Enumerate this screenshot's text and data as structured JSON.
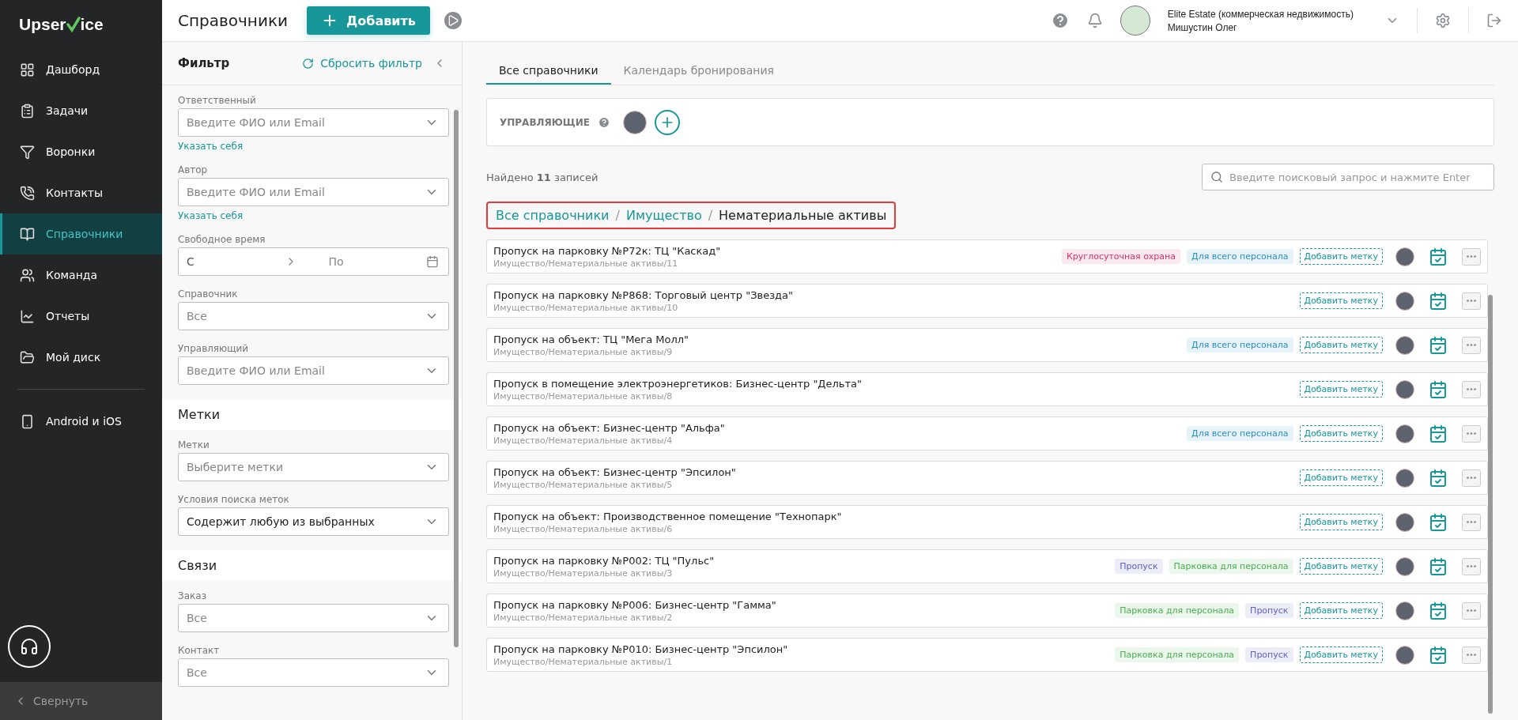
{
  "logo": {
    "before": "Upser",
    "after": "ice"
  },
  "nav": [
    {
      "label": "Дашборд",
      "selected": false
    },
    {
      "label": "Задачи",
      "selected": false
    },
    {
      "label": "Воронки",
      "selected": false
    },
    {
      "label": "Контакты",
      "selected": false
    },
    {
      "label": "Справочники",
      "selected": true
    },
    {
      "label": "Команда",
      "selected": false
    },
    {
      "label": "Отчеты",
      "selected": false
    },
    {
      "label": "Мой диск",
      "selected": false
    }
  ],
  "nav_extra": {
    "label": "Android и iOS"
  },
  "collapse": {
    "label": "Свернуть"
  },
  "header": {
    "title": "Справочники",
    "add_button": "Добавить",
    "company": "Elite Estate (коммерческая недвижимость)",
    "user": "Мишустин Олег"
  },
  "filter": {
    "title": "Фильтр",
    "reset": "Сбросить фильтр",
    "sections": [
      {
        "fields": [
          {
            "kind": "select",
            "label": "Ответственный",
            "placeholder": "Введите ФИО или Email",
            "link": "Указать себя"
          },
          {
            "kind": "select",
            "label": "Автор",
            "placeholder": "Введите ФИО или Email",
            "link": "Указать себя"
          },
          {
            "kind": "range",
            "label": "Свободное время",
            "from": "С",
            "to": "По"
          },
          {
            "kind": "select",
            "label": "Справочник",
            "placeholder": "Все"
          },
          {
            "kind": "select",
            "label": "Управляющий",
            "placeholder": "Введите ФИО или Email"
          }
        ]
      },
      {
        "heading": "Метки",
        "fields": [
          {
            "kind": "select",
            "label": "Метки",
            "placeholder": "Выберите метки"
          },
          {
            "kind": "select",
            "label": "Условия поиска меток",
            "value": "Содержит любую из выбранных"
          }
        ]
      },
      {
        "heading": "Связи",
        "fields": [
          {
            "kind": "select",
            "label": "Заказ",
            "placeholder": "Все"
          },
          {
            "kind": "select",
            "label": "Контакт",
            "placeholder": "Все"
          }
        ]
      }
    ]
  },
  "tabs": [
    {
      "label": "Все справочники",
      "selected": true
    },
    {
      "label": "Календарь бронирования",
      "selected": false
    }
  ],
  "managers": {
    "label": "УПРАВЛЯЮЩИЕ"
  },
  "found": "Найдено **11** записей",
  "search": {
    "placeholder": "Введите поисковый запрос и нажмите Enter"
  },
  "breadcrumb": [
    {
      "label": "Все справочники",
      "current": false
    },
    {
      "separator": "/",
      "label": "Имущество",
      "current": false
    },
    {
      "separator": "/",
      "label": "Нематериальные активы",
      "current": true
    }
  ],
  "rows": [
    {
      "title": "Пропуск на парковку №Р72к: ТЦ \"Каскад\"",
      "path": "Имущество/Нематериальные активы/11",
      "add_tag": "Добавить метку",
      "tags": [
        {
          "label": "Круглосуточная охрана",
          "color": "#d6336c"
        },
        {
          "label": "Для всего персонала",
          "color": "#2b8fc7"
        }
      ]
    },
    {
      "title": "Пропуск на парковку №Р868: Торговый центр \"Звезда\"",
      "path": "Имущество/Нематериальные активы/10",
      "add_tag": "Добавить метку",
      "tags": []
    },
    {
      "title": "Пропуск на объект: ТЦ \"Мега Молл\"",
      "path": "Имущество/Нематериальные активы/9",
      "add_tag": "Добавить метку",
      "tags": [
        {
          "label": "Для всего персонала",
          "color": "#2b8fc7"
        }
      ]
    },
    {
      "title": "Пропуск в помещение электроэнергетиков: Бизнес-центр \"Дельта\"",
      "path": "Имущество/Нематериальные активы/8",
      "add_tag": "Добавить метку",
      "tags": []
    },
    {
      "title": "Пропуск на объект: Бизнес-центр \"Альфа\"",
      "path": "Имущество/Нематериальные активы/4",
      "add_tag": "Добавить метку",
      "tags": [
        {
          "label": "Для всего персонала",
          "color": "#2b8fc7"
        }
      ]
    },
    {
      "title": "Пропуск на объект: Бизнес-центр \"Эпсилон\"",
      "path": "Имущество/Нематериальные активы/5",
      "add_tag": "Добавить метку",
      "tags": []
    },
    {
      "title": "Пропуск на объект: Производственное помещение \"Технопарк\"",
      "path": "Имущество/Нематериальные активы/6",
      "add_tag": "Добавить метку",
      "tags": []
    },
    {
      "title": "Пропуск на парковку №Р002: ТЦ \"Пульс\"",
      "path": "Имущество/Нематериальные активы/3",
      "add_tag": "Добавить метку",
      "tags": [
        {
          "label": "Пропуск",
          "color": "#5c5fc0"
        },
        {
          "label": "Парковка для персонала",
          "color": "#4caf50"
        }
      ]
    },
    {
      "title": "Пропуск на парковку №Р006: Бизнес-центр \"Гамма\"",
      "path": "Имущество/Нематериальные активы/2",
      "add_tag": "Добавить метку",
      "tags": [
        {
          "label": "Парковка для персонала",
          "color": "#4caf50"
        },
        {
          "label": "Пропуск",
          "color": "#5c5fc0"
        }
      ]
    },
    {
      "title": "Пропуск на парковку №Р010: Бизнес-центр \"Эпсилон\"",
      "path": "Имущество/Нематериальные активы/1",
      "add_tag": "Добавить метку",
      "tags": [
        {
          "label": "Парковка для персонала",
          "color": "#4caf50"
        },
        {
          "label": "Пропуск",
          "color": "#5c5fc0"
        }
      ]
    }
  ]
}
